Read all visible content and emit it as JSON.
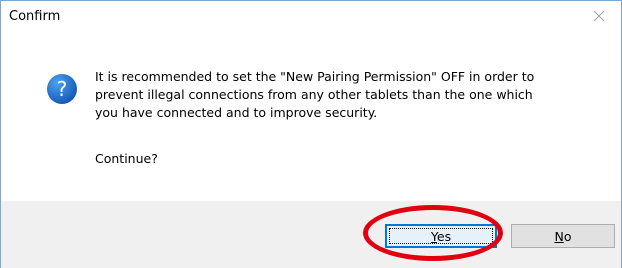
{
  "dialog": {
    "title": "Confirm",
    "close_icon": "close-icon",
    "icon": "question-icon",
    "message": "It is recommended to set the \"New Pairing Permission\" OFF in order to\nprevent illegal connections from any other tablets than the one which\nyou have connected and to improve security.",
    "continue_prompt": "Continue?"
  },
  "buttons": {
    "yes_label": "Yes",
    "no_label": "No"
  },
  "colors": {
    "accent": "#0078d7",
    "annotation_red": "#e0000f",
    "icon_blue": "#1565c0",
    "footer_bg": "#f0f0f0"
  }
}
